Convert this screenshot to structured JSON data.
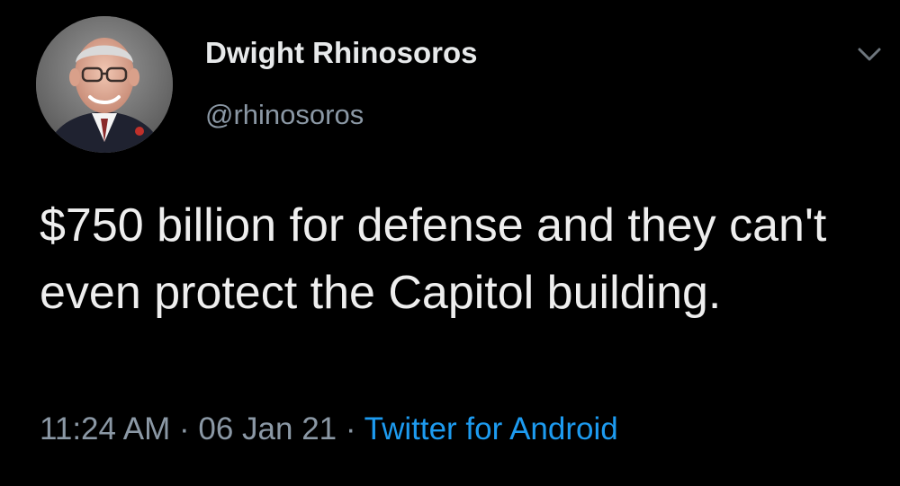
{
  "tweet": {
    "author": {
      "display_name": "Dwight Rhinosoros",
      "handle": "@rhinosoros",
      "avatar_icon": "profile-photo-icon"
    },
    "menu_icon": "chevron-down-icon",
    "text": "$750 billion for defense and they can't even protect the Capitol building.",
    "time": "11:24 AM",
    "separator": "·",
    "date": "06 Jan 21",
    "source": "Twitter for Android"
  },
  "colors": {
    "background": "#000000",
    "primary_text": "#e7e9ea",
    "secondary_text": "#8b98a5",
    "link": "#1d9bf0"
  }
}
